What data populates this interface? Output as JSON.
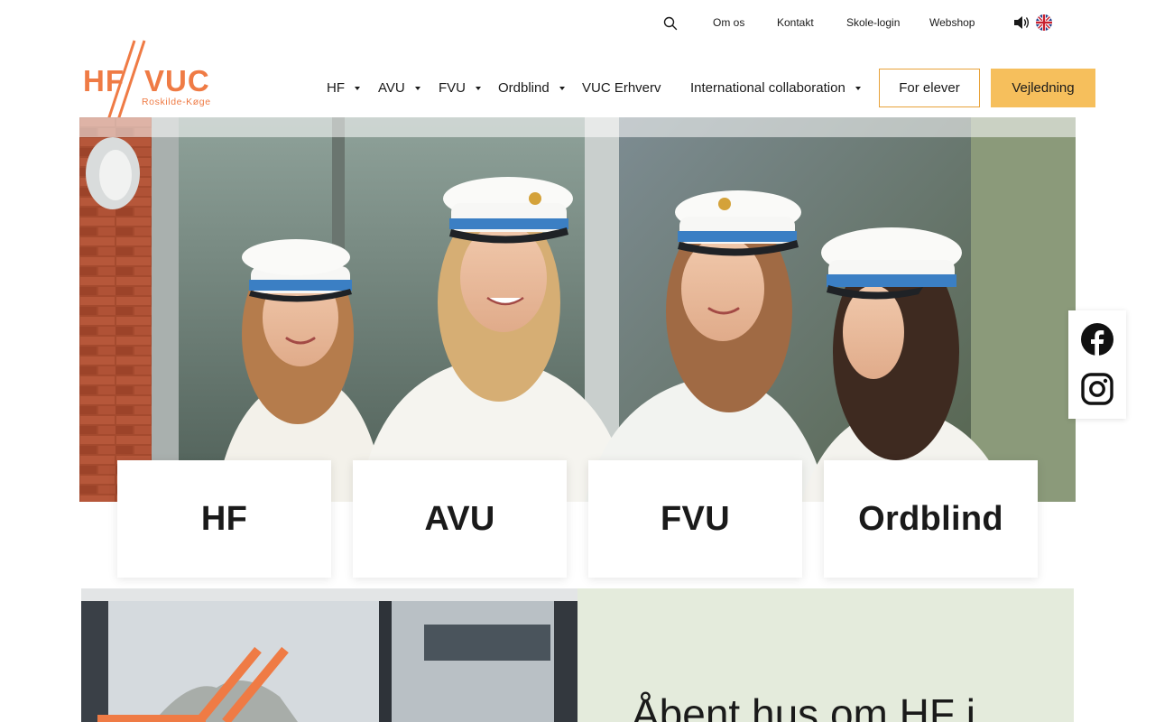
{
  "utility": {
    "search_icon": "search-icon",
    "links": [
      "Om os",
      "Kontakt",
      "Skole-login",
      "Webshop"
    ],
    "audio_icon": "speaker-icon",
    "language_icon": "uk-flag-icon"
  },
  "logo": {
    "left_text": "HF",
    "right_text": "VUC",
    "tagline": "Roskilde-Køge",
    "color": "#ef7b45"
  },
  "nav": {
    "items": [
      {
        "label": "HF",
        "has_dropdown": true
      },
      {
        "label": "AVU",
        "has_dropdown": true
      },
      {
        "label": "FVU",
        "has_dropdown": true
      },
      {
        "label": "Ordblind",
        "has_dropdown": true
      },
      {
        "label": "VUC Erhverv",
        "has_dropdown": false
      },
      {
        "label": "International collaboration",
        "has_dropdown": true
      }
    ],
    "for_elever_label": "For elever",
    "vejledning_label": "Vejledning"
  },
  "colors": {
    "accent_orange": "#ef7b45",
    "button_yellow": "#f6bf5c",
    "button_border": "#e8a23a",
    "panel_green": "#e4ebdc"
  },
  "social": {
    "icons": [
      "facebook-icon",
      "instagram-icon"
    ]
  },
  "cards": [
    {
      "label": "HF"
    },
    {
      "label": "AVU"
    },
    {
      "label": "FVU"
    },
    {
      "label": "Ordblind"
    }
  ],
  "bottom": {
    "heading": "Åbent hus om HF i"
  }
}
